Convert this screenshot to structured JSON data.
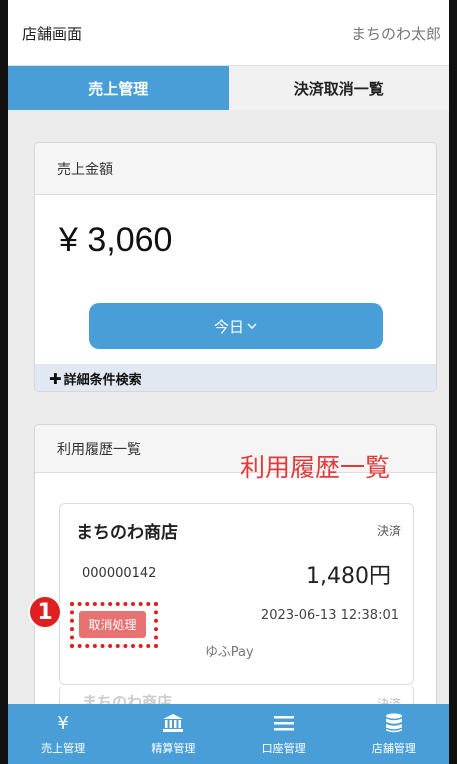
{
  "header": {
    "title": "店舗画面",
    "user": "まちのわ太郎"
  },
  "tabs": [
    {
      "label": "売上管理",
      "active": true
    },
    {
      "label": "決済取消一覧",
      "active": false
    }
  ],
  "sales": {
    "section_title": "売上金額",
    "amount": "¥ 3,060",
    "period_button": "今日",
    "period_chevron": "chevron-down-icon",
    "detail_search_plus": "✚",
    "detail_search": "詳細条件検索"
  },
  "history": {
    "section_title": "利用履歴一覧",
    "annotation": "利用履歴一覧",
    "items": [
      {
        "shop": "まちのわ商店",
        "type": "決済",
        "id": "000000142",
        "amount": "1,480円",
        "datetime": "2023-06-13 12:38:01",
        "cancel_label": "取消処理",
        "method": "ゆふPay"
      },
      {
        "shop": "まちのわ商店",
        "type": "決済"
      }
    ]
  },
  "step_badge": "1",
  "bottom_nav": [
    {
      "label": "売上管理",
      "icon": "yen-icon"
    },
    {
      "label": "精算管理",
      "icon": "bank-icon"
    },
    {
      "label": "口座管理",
      "icon": "menu-icon"
    },
    {
      "label": "店舗管理",
      "icon": "database-icon"
    }
  ],
  "colors": {
    "accent": "#4a9ed8",
    "cancel": "#e77272",
    "annotation": "#e03a3a"
  }
}
